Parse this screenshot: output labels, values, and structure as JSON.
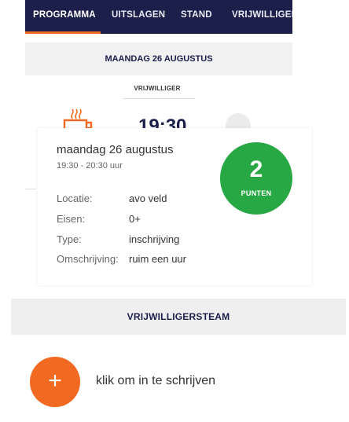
{
  "nav": {
    "tabs": [
      {
        "label": "PROGRAMMA",
        "active": true
      },
      {
        "label": "UITSLAGEN",
        "active": false
      },
      {
        "label": "STAND",
        "active": false
      },
      {
        "label": "VRIJWILLIGER",
        "active": false
      }
    ]
  },
  "schedule": {
    "date_header": "MAANDAG 26 AUGUSTUS",
    "role_label": "VRIJWILLIGER",
    "time_behind": "19:30",
    "icon": "coffee-cup-icon"
  },
  "detail": {
    "title": "maandag 26 augustus",
    "time_range": "19:30 - 20:30 uur",
    "rows": [
      {
        "label": "Locatie:",
        "value": "avo veld"
      },
      {
        "label": "Eisen:",
        "value": "0+"
      },
      {
        "label": "Type:",
        "value": "inschrijving"
      },
      {
        "label": "Omschrijving:",
        "value": "ruim een uur"
      }
    ],
    "points": {
      "value": "2",
      "label": "PUNTEN",
      "color": "#28a745"
    }
  },
  "team": {
    "header": "VRIJWILLIGERSTEAM",
    "signup_text": "klik om in te schrijven",
    "add_icon": "plus-icon",
    "accent": "#f26a21"
  },
  "colors": {
    "navy": "#1c1f4a",
    "orange": "#f26a21",
    "green": "#28a745"
  }
}
